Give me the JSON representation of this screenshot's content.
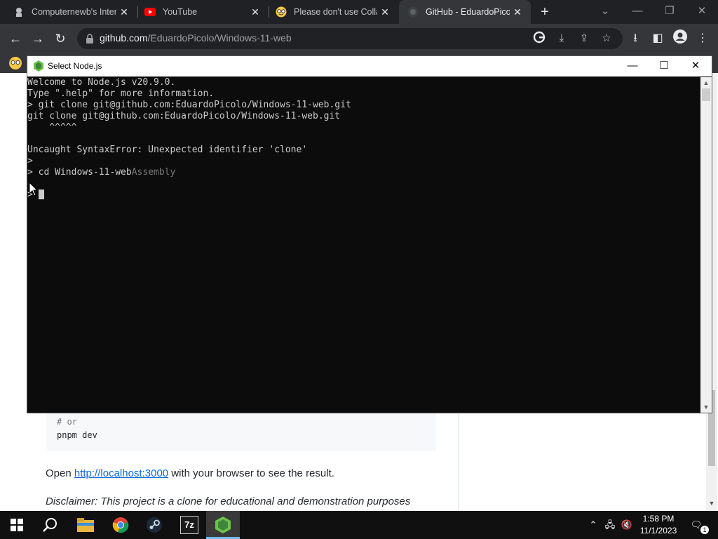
{
  "browser": {
    "tabs": [
      {
        "title": "Computernewb's Inter",
        "icon": "computernewb-icon",
        "active": false
      },
      {
        "title": "YouTube",
        "icon": "youtube-icon",
        "active": false
      },
      {
        "title": "Please don't use Colla",
        "icon": "glasses-emoji-icon",
        "active": false
      },
      {
        "title": "GitHub - EduardoPicol",
        "icon": "github-icon",
        "active": true
      }
    ],
    "close_glyph": "✕",
    "new_tab_glyph": "+",
    "url_host": "github.com",
    "url_path": "/EduardoPicolo/Windows-11-web"
  },
  "page": {
    "code_comment": "# or",
    "code_command": "pnpm dev",
    "paragraph_prefix": "Open ",
    "paragraph_link": "http://localhost:3000",
    "paragraph_suffix": " with your browser to see the result.",
    "disclaimer": "Disclaimer: This project is a clone for educational and demonstration purposes"
  },
  "console": {
    "title": "Select Node.js",
    "lines": [
      "Welcome to Node.js v20.9.0.",
      "Type \".help\" for more information.",
      "> git clone git@github.com:EduardoPicolo/Windows-11-web.git",
      "git clone git@github.com:EduardoPicolo/Windows-11-web.git",
      "    ^^^^^",
      "",
      "Uncaught SyntaxError: Unexpected identifier 'clone'",
      ">",
      "> cd Windows-11-web"
    ],
    "autocomplete_hint": "Assembly",
    "cursor_prompt": ">"
  },
  "taskbar": {
    "apps": [
      "start-icon",
      "search-icon",
      "file-explorer-icon",
      "chrome-icon",
      "steam-icon",
      "7zip-icon",
      "nodejs-icon"
    ],
    "sevenzip_label": "7z",
    "time": "1:58 PM",
    "date": "11/1/2023",
    "notification_count": "1"
  },
  "colors": {
    "console_bg": "#0c0c0c",
    "console_text": "#cccccc",
    "chrome_dark": "#202124",
    "chrome_toolbar": "#35363a",
    "nodejs_green": "#6cc24a",
    "link_blue": "#0969da"
  }
}
